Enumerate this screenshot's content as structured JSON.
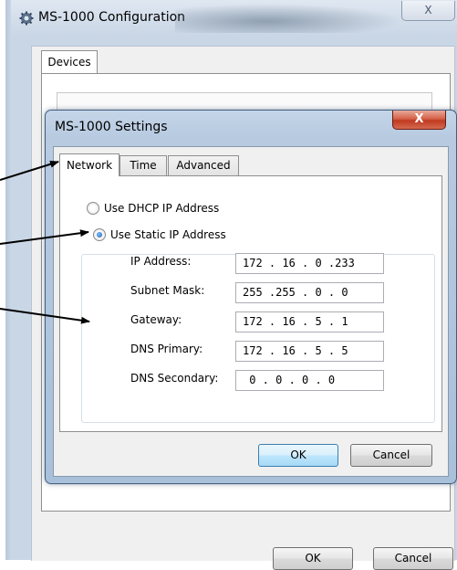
{
  "outer_window": {
    "title": "MS-1000 Configuration",
    "close_glyph": "X",
    "tab": "Devices",
    "ok_label": "OK",
    "cancel_label": "Cancel"
  },
  "dialog": {
    "title": "MS-1000 Settings",
    "close_glyph": "X",
    "tabs": [
      {
        "label": "Network",
        "active": true
      },
      {
        "label": "Time",
        "active": false
      },
      {
        "label": "Advanced",
        "active": false
      }
    ],
    "dhcp_label": "Use DHCP IP Address",
    "dhcp_checked": false,
    "static_label": "Use Static IP Address",
    "static_checked": true,
    "fields": [
      {
        "label": "IP Address:",
        "value": "172 . 16 . 0 .233"
      },
      {
        "label": "Subnet Mask:",
        "value": "255 .255 . 0 . 0"
      },
      {
        "label": "Gateway:",
        "value": "172 . 16 . 5 . 1"
      },
      {
        "label": "DNS Primary:",
        "value": "172 . 16 . 5 . 5"
      },
      {
        "label": "DNS Secondary:",
        "value": " 0 . 0 . 0 . 0"
      }
    ],
    "ok_label": "OK",
    "cancel_label": "Cancel"
  },
  "colors": {
    "radio_dot": "#1f5aa8",
    "close_button": "#c0391f",
    "default_button_border": "#3c7fb1"
  },
  "icons": [
    "gear-app-icon",
    "close-icon",
    "radio-icon",
    "arrow-icon"
  ]
}
